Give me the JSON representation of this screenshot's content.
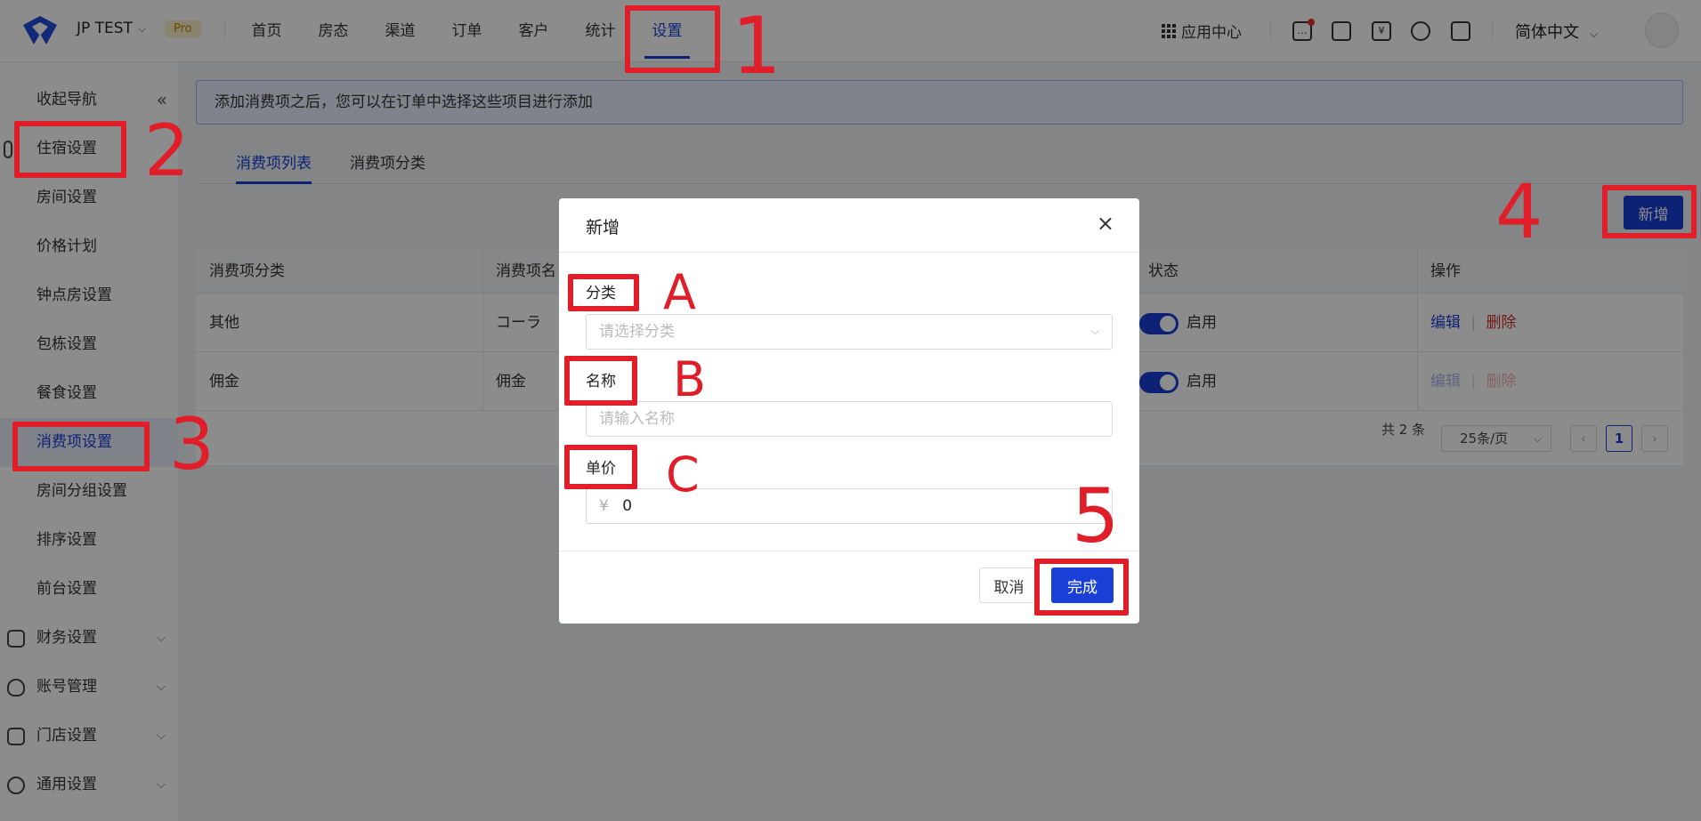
{
  "topbar": {
    "brand": "JP TEST",
    "badge": "Pro",
    "nav": [
      "首页",
      "房态",
      "渠道",
      "订单",
      "客户",
      "统计",
      "设置"
    ],
    "active_nav": "设置",
    "apps_label": "应用中心",
    "language": "简体中文"
  },
  "sidebar": {
    "collapse_label": "收起导航",
    "items": [
      "住宿设置",
      "房间设置",
      "价格计划",
      "钟点房设置",
      "包栋设置",
      "餐食设置",
      "消费项设置",
      "房间分组设置",
      "排序设置",
      "前台设置",
      "财务设置",
      "账号管理",
      "门店设置",
      "通用设置"
    ],
    "active": "消费项设置"
  },
  "main": {
    "info": "添加消费项之后，您可以在订单中选择这些项目进行添加",
    "tabs": [
      "消费项列表",
      "消费项分类"
    ],
    "add_button": "新增",
    "table": {
      "columns": [
        "消费项分类",
        "消费项名",
        "状态",
        "操作"
      ],
      "rows": [
        {
          "category": "其他",
          "name": "コーラ",
          "status": "启用",
          "edit": "编辑",
          "delete": "删除"
        },
        {
          "category": "佣金",
          "name": "佣金",
          "status": "启用",
          "edit": "编辑",
          "delete": "删除"
        }
      ]
    },
    "pagination": {
      "total": "共 2 条",
      "page_size": "25条/页",
      "page": "1"
    }
  },
  "modal": {
    "title": "新增",
    "category_label": "分类",
    "category_placeholder": "请选择分类",
    "name_label": "名称",
    "name_placeholder": "请输入名称",
    "price_label": "单价",
    "currency": "¥",
    "price_value": "0",
    "cancel": "取消",
    "confirm": "完成"
  },
  "annotations": [
    "1",
    "2",
    "3",
    "4",
    "5",
    "A",
    "B",
    "C"
  ],
  "colors": {
    "accent": "#1a3fd6",
    "annotation": "#e01e2a",
    "danger": "#d0312d"
  }
}
